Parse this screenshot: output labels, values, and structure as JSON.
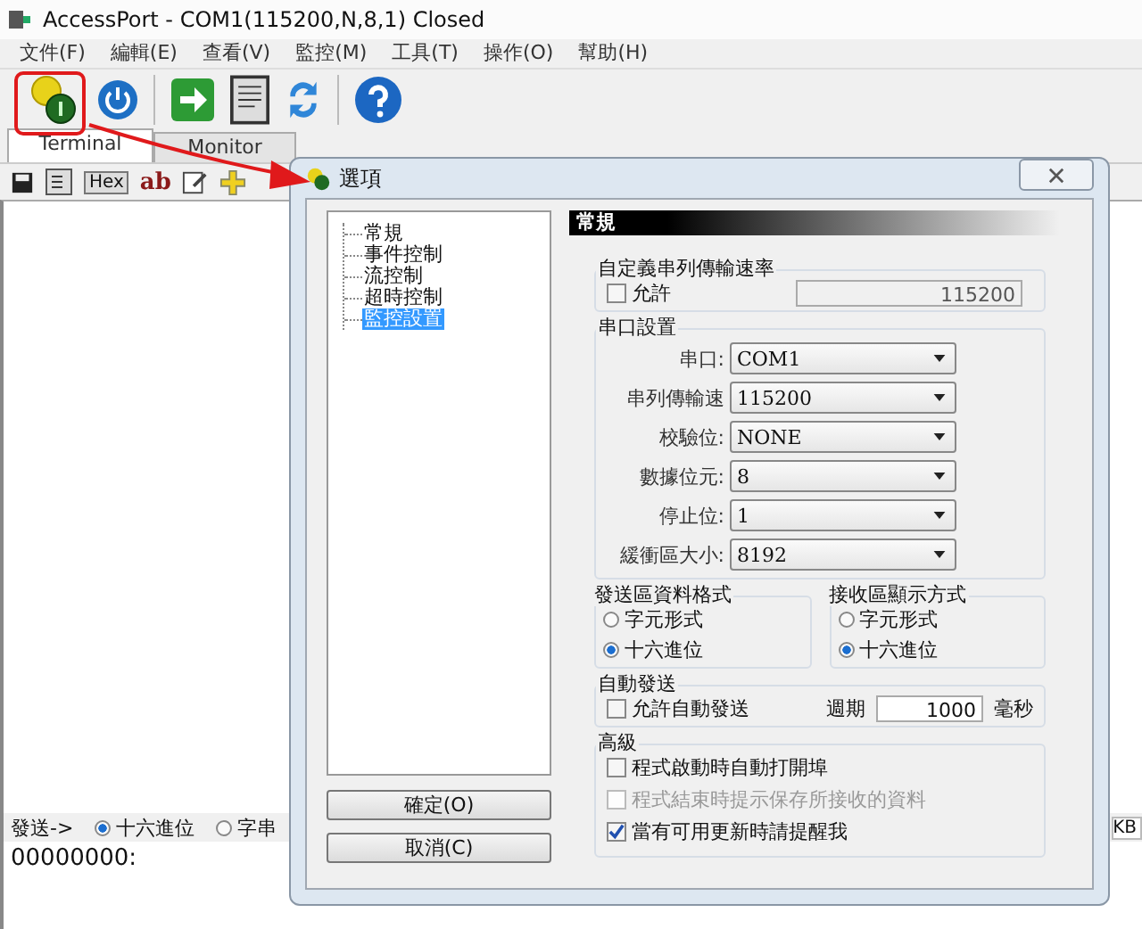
{
  "window": {
    "title": "AccessPort - COM1(115200,N,8,1) Closed"
  },
  "menu": [
    "文件(F)",
    "編輯(E)",
    "查看(V)",
    "監控(M)",
    "工具(T)",
    "操作(O)",
    "幫助(H)"
  ],
  "tabs": [
    {
      "label": "Terminal",
      "selected": true
    },
    {
      "label": "Monitor",
      "selected": false
    }
  ],
  "sub_toolbar": {
    "hex_label": "Hex",
    "ab_label": "ab"
  },
  "send_bar": {
    "label": "發送->",
    "options": [
      {
        "label": "十六進位",
        "selected": true
      },
      {
        "label": "字串",
        "selected": false
      }
    ],
    "size_unit": "KB"
  },
  "hex_view": {
    "text": "00000000:"
  },
  "dialog": {
    "title": "選項",
    "tree": [
      {
        "label": "常規",
        "selected": false
      },
      {
        "label": "事件控制",
        "selected": false
      },
      {
        "label": "流控制",
        "selected": false
      },
      {
        "label": "超時控制",
        "selected": false
      },
      {
        "label": "監控設置",
        "selected": true
      }
    ],
    "buttons": [
      "確定(O)",
      "取消(C)"
    ],
    "panel": {
      "heading": "常規",
      "custom_baud": {
        "title": "自定義串列傳輸速率",
        "checkbox": {
          "label": "允許",
          "checked": false
        },
        "value": "115200"
      },
      "port_settings": {
        "title": "串口設置",
        "fields": [
          {
            "label": "串口:",
            "value": "COM1"
          },
          {
            "label": "串列傳輸速",
            "value": "115200"
          },
          {
            "label": "校驗位:",
            "value": "NONE"
          },
          {
            "label": "數據位元:",
            "value": "8"
          },
          {
            "label": "停止位:",
            "value": "1"
          },
          {
            "label": "緩衝區大小:",
            "value": "8192"
          }
        ]
      },
      "send_format": {
        "title": "發送區資料格式",
        "options": [
          {
            "label": "字元形式",
            "selected": false
          },
          {
            "label": "十六進位",
            "selected": true
          }
        ]
      },
      "receive_format": {
        "title": "接收區顯示方式",
        "options": [
          {
            "label": "字元形式",
            "selected": false
          },
          {
            "label": "十六進位",
            "selected": true
          }
        ]
      },
      "auto_send": {
        "title": "自動發送",
        "checkbox": {
          "label": "允許自動發送",
          "checked": false
        },
        "period_label": "週期",
        "period": "1000",
        "unit": "毫秒"
      },
      "advanced": {
        "title": "高級",
        "options": [
          {
            "label": "程式啟動時自動打開埠",
            "checked": false,
            "disabled": false
          },
          {
            "label": "程式結束時提示保存所接收的資料",
            "checked": false,
            "disabled": true
          },
          {
            "label": "當有可用更新時請提醒我",
            "checked": true,
            "disabled": false
          }
        ]
      }
    }
  }
}
